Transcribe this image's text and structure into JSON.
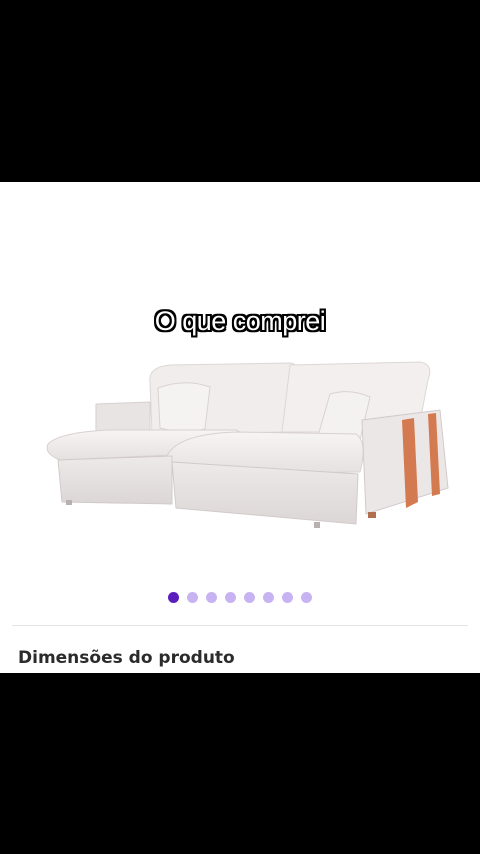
{
  "overlay": {
    "caption": "O que comprei"
  },
  "product": {
    "image_description_icon": "sofa-image",
    "carousel": {
      "total": 8,
      "active_index": 0
    }
  },
  "section": {
    "title": "Dimensões do produto"
  },
  "colors": {
    "accent": "#5a1ebd",
    "accent_light": "#c7b3f2"
  }
}
